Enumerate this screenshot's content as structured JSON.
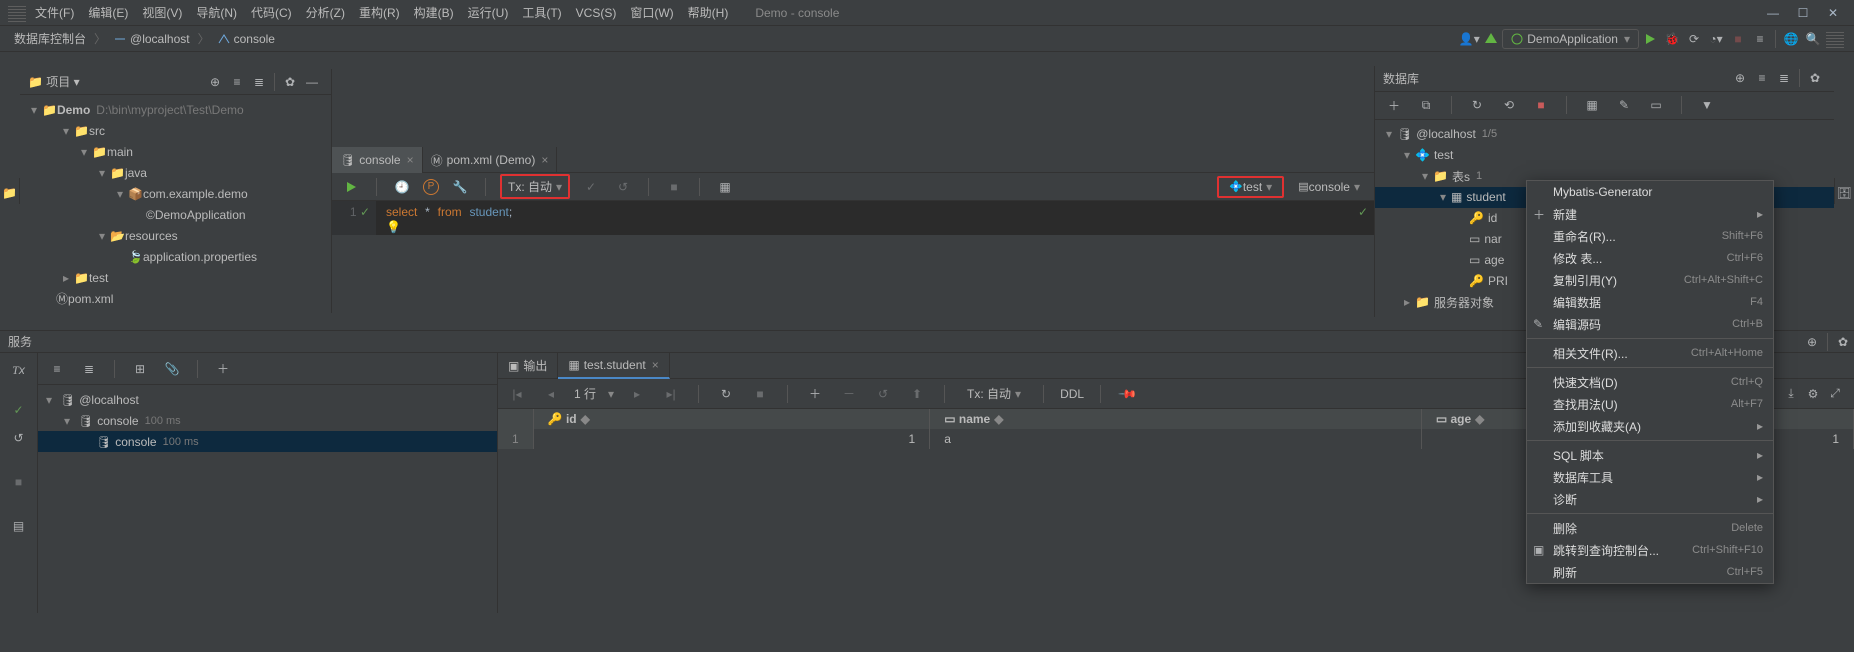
{
  "menubar": [
    "文件(F)",
    "编辑(E)",
    "视图(V)",
    "导航(N)",
    "代码(C)",
    "分析(Z)",
    "重构(R)",
    "构建(B)",
    "运行(U)",
    "工具(T)",
    "VCS(S)",
    "窗口(W)",
    "帮助(H)"
  ],
  "window_title": "Demo - console",
  "breadcrumb": {
    "root": "数据库控制台",
    "items": [
      "@localhost",
      "console"
    ]
  },
  "run_config": "DemoApplication",
  "project": {
    "title": "项目",
    "root": {
      "name": "Demo",
      "path": "D:\\bin\\myproject\\Test\\Demo"
    },
    "tree": [
      {
        "depth": 1,
        "caret": "▾",
        "icon": "folder",
        "label": "src"
      },
      {
        "depth": 2,
        "caret": "▾",
        "icon": "folder",
        "label": "main"
      },
      {
        "depth": 3,
        "caret": "▾",
        "icon": "folder",
        "label": "java"
      },
      {
        "depth": 4,
        "caret": "▾",
        "icon": "package",
        "label": "com.example.demo"
      },
      {
        "depth": 5,
        "caret": "",
        "icon": "class",
        "label": "DemoApplication"
      },
      {
        "depth": 3,
        "caret": "▾",
        "icon": "resources",
        "label": "resources"
      },
      {
        "depth": 4,
        "caret": "",
        "icon": "leaf",
        "label": "application.properties"
      },
      {
        "depth": 1,
        "caret": "▸",
        "icon": "folder",
        "label": "test"
      },
      {
        "depth": 0,
        "caret": "",
        "icon": "maven",
        "label": "pom.xml"
      }
    ]
  },
  "editor": {
    "tabs": [
      {
        "icon": "sql",
        "label": "console",
        "active": true
      },
      {
        "icon": "maven",
        "label": "pom.xml (Demo)",
        "active": false
      }
    ],
    "tx_label": "Tx: 自动",
    "datasource": "test",
    "console": "console",
    "line_no": "1",
    "code": {
      "kw1": "select",
      "star": "*",
      "kw2": "from",
      "ident": "student",
      "semi": ";"
    }
  },
  "services": {
    "title": "服务",
    "tree": [
      {
        "depth": 0,
        "caret": "▾",
        "icon": "sql",
        "label": "@localhost",
        "meta": ""
      },
      {
        "depth": 1,
        "caret": "▾",
        "icon": "sql",
        "label": "console",
        "meta": "100 ms"
      },
      {
        "depth": 2,
        "caret": "",
        "icon": "sql",
        "label": "console",
        "meta": "100 ms",
        "sel": true
      }
    ]
  },
  "result": {
    "tabs": [
      {
        "icon": "out",
        "label": "输出",
        "active": false
      },
      {
        "icon": "table",
        "label": "test.student",
        "active": true,
        "closable": true
      }
    ],
    "rows_label": "1 行",
    "tx_label": "Tx: 自动",
    "ddl": "DDL",
    "columns": [
      "id",
      "name",
      "age"
    ],
    "data": [
      {
        "row": "1",
        "id": "1",
        "name": "a",
        "age": "1"
      }
    ]
  },
  "db": {
    "title": "数据库",
    "tree": [
      {
        "depth": 0,
        "caret": "▾",
        "icon": "sql",
        "label": "@localhost",
        "meta": "1/5"
      },
      {
        "depth": 1,
        "caret": "▾",
        "icon": "schema",
        "label": "test",
        "meta": ""
      },
      {
        "depth": 2,
        "caret": "▾",
        "icon": "folder",
        "label": "表s",
        "meta": "1"
      },
      {
        "depth": 3,
        "caret": "▾",
        "icon": "table",
        "label": "student",
        "meta": "",
        "sel": true
      },
      {
        "depth": 4,
        "caret": "",
        "icon": "idcol",
        "label": "id",
        "meta": ""
      },
      {
        "depth": 4,
        "caret": "",
        "icon": "col",
        "label": "nar",
        "meta": ""
      },
      {
        "depth": 4,
        "caret": "",
        "icon": "col",
        "label": "age",
        "meta": ""
      },
      {
        "depth": 4,
        "caret": "",
        "icon": "key",
        "label": "PRI",
        "meta": ""
      },
      {
        "depth": 1,
        "caret": "▸",
        "icon": "folder",
        "label": "服务器对象",
        "meta": ""
      }
    ]
  },
  "context_menu": [
    {
      "type": "item",
      "label": "Mybatis-Generator"
    },
    {
      "type": "item",
      "icon": "plus",
      "label": "新建",
      "sub": true
    },
    {
      "type": "item",
      "label": "重命名(R)...",
      "short": "Shift+F6"
    },
    {
      "type": "item",
      "label": "修改 表...",
      "short": "Ctrl+F6"
    },
    {
      "type": "item",
      "label": "复制引用(Y)",
      "short": "Ctrl+Alt+Shift+C"
    },
    {
      "type": "item",
      "label": "编辑数据",
      "short": "F4"
    },
    {
      "type": "item",
      "icon": "pencil",
      "label": "编辑源码",
      "short": "Ctrl+B"
    },
    {
      "type": "sep"
    },
    {
      "type": "item",
      "label": "相关文件(R)...",
      "short": "Ctrl+Alt+Home"
    },
    {
      "type": "sep"
    },
    {
      "type": "item",
      "label": "快速文档(D)",
      "short": "Ctrl+Q"
    },
    {
      "type": "item",
      "label": "查找用法(U)",
      "short": "Alt+F7"
    },
    {
      "type": "item",
      "label": "添加到收藏夹(A)",
      "sub": true
    },
    {
      "type": "sep"
    },
    {
      "type": "item",
      "label": "SQL 脚本",
      "sub": true
    },
    {
      "type": "item",
      "label": "数据库工具",
      "sub": true
    },
    {
      "type": "item",
      "label": "诊断",
      "sub": true
    },
    {
      "type": "sep"
    },
    {
      "type": "item",
      "label": "删除",
      "short": "Delete"
    },
    {
      "type": "item",
      "icon": "jump",
      "label": "跳转到查询控制台...",
      "short": "Ctrl+Shift+F10"
    },
    {
      "type": "item",
      "label": "刷新",
      "short": "Ctrl+F5"
    }
  ]
}
